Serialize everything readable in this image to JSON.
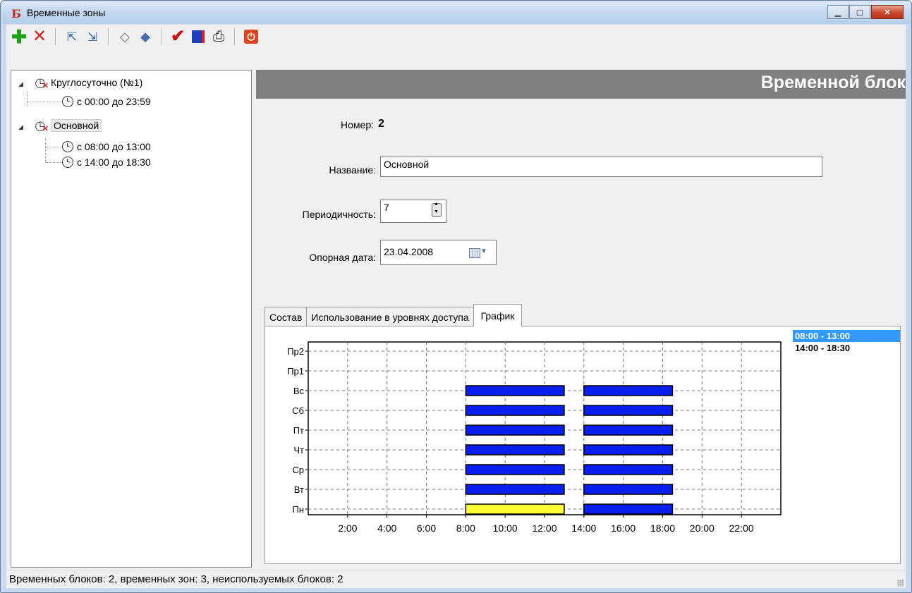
{
  "window": {
    "title": "Временные зоны",
    "controls": [
      "minimize",
      "maximize",
      "close"
    ]
  },
  "toolbar": {
    "buttons": [
      {
        "name": "add",
        "icon": "plus-icon",
        "color": "#1aa31a"
      },
      {
        "name": "delete",
        "icon": "delete-x-icon",
        "color": "#e02020"
      },
      {
        "name": "export",
        "icon": "export-icon"
      },
      {
        "name": "import",
        "icon": "import-icon"
      },
      {
        "name": "clear",
        "icon": "eraser-icon"
      },
      {
        "name": "edit",
        "icon": "pencil-eraser-icon"
      },
      {
        "name": "apply",
        "icon": "checkmark-icon",
        "color": "#cc1111"
      },
      {
        "name": "exit-door",
        "icon": "exit-icon"
      },
      {
        "name": "print",
        "icon": "printer-icon"
      },
      {
        "name": "power",
        "icon": "power-icon",
        "color": "#e0441c"
      }
    ]
  },
  "tree": {
    "items": [
      {
        "label": "Круглосуточно (№1)",
        "children": [
          "с 00:00 до 23:59"
        ]
      },
      {
        "label": "Основной",
        "selected": true,
        "children": [
          "с 08:00 до 13:00",
          "с 14:00 до 18:30"
        ]
      }
    ]
  },
  "detail": {
    "header": "Временной блок",
    "number_label": "Номер:",
    "number_value": "2",
    "name_label": "Название:",
    "name_value": "Основной",
    "period_label": "Периодичность:",
    "period_value": "7",
    "date_label": "Опорная дата:",
    "date_value": "23.04.2008"
  },
  "tabs": [
    {
      "label": "Состав",
      "active": false
    },
    {
      "label": "Использование в уровнях доступа",
      "active": false
    },
    {
      "label": "График",
      "active": true
    }
  ],
  "chart_data": {
    "type": "bar",
    "orientation": "horizontal-gantt",
    "categories": [
      "Пр2",
      "Пр1",
      "Вс",
      "Сб",
      "Пт",
      "Чт",
      "Ср",
      "Вт",
      "Пн"
    ],
    "x_ticks": [
      "2:00",
      "4:00",
      "6:00",
      "8:00",
      "10:00",
      "12:00",
      "14:00",
      "16:00",
      "18:00",
      "20:00",
      "22:00"
    ],
    "xlim": [
      0,
      24
    ],
    "grid": true,
    "legend_position": "top-right",
    "series": [
      {
        "name": "08:00 - 13:00",
        "start": 8,
        "end": 13,
        "days": [
          "Вс",
          "Сб",
          "Пт",
          "Чт",
          "Ср",
          "Вт",
          "Пн"
        ],
        "color": "#0a1ef0",
        "selected_color": "#ffff33",
        "selected": true
      },
      {
        "name": "14:00 - 18:30",
        "start": 14,
        "end": 18.5,
        "days": [
          "Вс",
          "Сб",
          "Пт",
          "Чт",
          "Ср",
          "Вт",
          "Пн"
        ],
        "color": "#0a1ef0"
      }
    ],
    "highlight_day": "Пн"
  },
  "status": {
    "text": "Временных блоков: 2, временных зон: 3, неиспользуемых блоков: 2"
  }
}
